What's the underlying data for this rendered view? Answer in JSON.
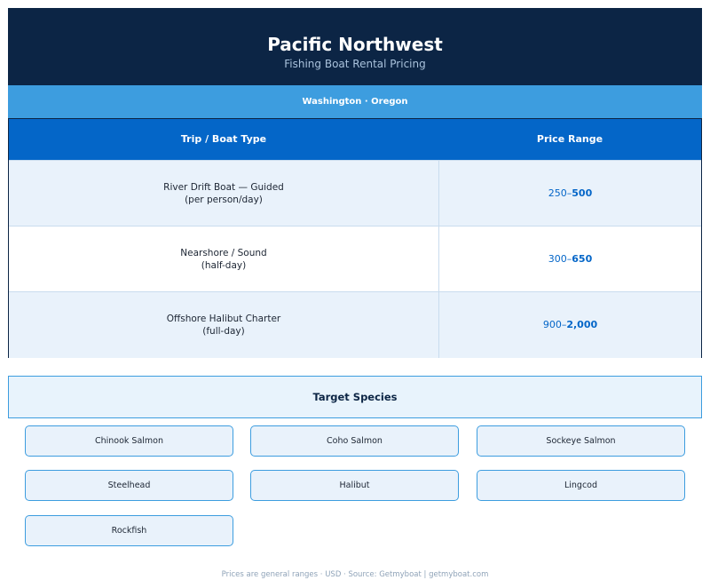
{
  "header": {
    "title": "Pacific Northwest",
    "subtitle": "Fishing Boat Rental Pricing"
  },
  "region": "Washington · Oregon",
  "table": {
    "headers": [
      "Trip / Boat Type",
      "Price Range"
    ],
    "rows": [
      {
        "type_line1": "River Drift Boat — Guided",
        "type_line2": "(per person/day)",
        "price_low": "250–",
        "price_high": "500"
      },
      {
        "type_line1": "Nearshore / Sound",
        "type_line2": "(half-day)",
        "price_low": "300–",
        "price_high": "650"
      },
      {
        "type_line1": "Offshore Halibut Charter",
        "type_line2": "(full-day)",
        "price_low": "900–",
        "price_high": "2,000"
      }
    ]
  },
  "species": {
    "title": "Target Species",
    "items": [
      "Chinook Salmon",
      "Coho Salmon",
      "Sockeye Salmon",
      "Steelhead",
      "Halibut",
      "Lingcod",
      "Rockfish"
    ]
  },
  "footer": "Prices are general ranges · USD · Source: Getmyboat  |  getmyboat.com",
  "colors": {
    "navy": "#0c2545",
    "accent_blue": "#0466c8",
    "light_blue": "#3d9ddf"
  }
}
